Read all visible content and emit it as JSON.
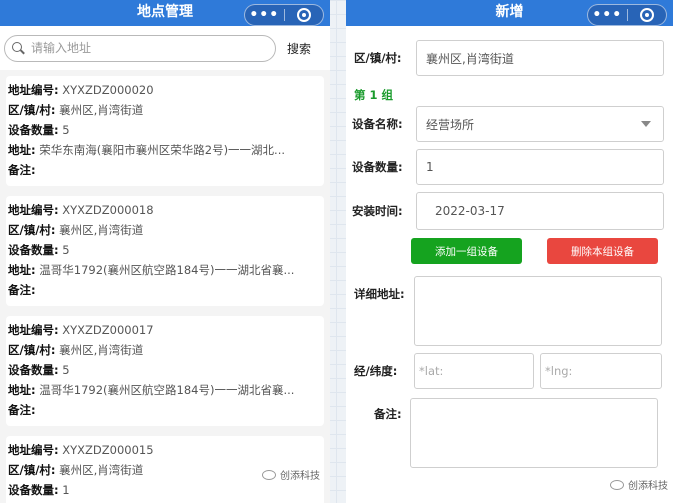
{
  "left": {
    "title": "地点管理",
    "capsule": {
      "more_label": "•••"
    },
    "search": {
      "placeholder": "请输入地址",
      "button_label": "搜索"
    },
    "labels": {
      "code": "地址编号:",
      "district": "区/镇/村:",
      "count": "设备数量:",
      "address": "地址:",
      "remark": "备注:"
    },
    "items": [
      {
        "code": "XYXZDZ000020",
        "district": "襄州区,肖湾街道",
        "count": "5",
        "address": "荣华东南海(襄阳市襄州区荣华路2号)一一湖北...",
        "remark": ""
      },
      {
        "code": "XYXZDZ000018",
        "district": "襄州区,肖湾街道",
        "count": "5",
        "address": "温哥华1792(襄州区航空路184号)一一湖北省襄...",
        "remark": ""
      },
      {
        "code": "XYXZDZ000017",
        "district": "襄州区,肖湾街道",
        "count": "5",
        "address": "温哥华1792(襄州区航空路184号)一一湖北省襄...",
        "remark": ""
      },
      {
        "code": "XYXZDZ000015",
        "district": "襄州区,肖湾街道",
        "count": "1"
      }
    ],
    "watermark": "创添科技"
  },
  "right": {
    "title": "新增",
    "capsule": {
      "more_label": "•••"
    },
    "district": {
      "label": "区/镇/村:",
      "value": "襄州区,肖湾街道"
    },
    "group_title": "第 1 组",
    "device_name": {
      "label": "设备名称:",
      "value": "经营场所"
    },
    "device_count": {
      "label": "设备数量:",
      "value": "1"
    },
    "install_time": {
      "label": "安装时间:",
      "value": "2022-03-17"
    },
    "add_group_label": "添加一组设备",
    "delete_group_label": "删除本组设备",
    "detail_address": {
      "label": "详细地址:"
    },
    "coords": {
      "label": "经/纬度:",
      "lat_placeholder": "*lat:",
      "lng_placeholder": "*lng:"
    },
    "remark": {
      "label": "备注:"
    },
    "watermark": "创添科技"
  },
  "colors": {
    "navbar": "#2f7ad9",
    "green": "#15a31f",
    "red": "#e9473f",
    "group_title": "#1a9b2c"
  }
}
